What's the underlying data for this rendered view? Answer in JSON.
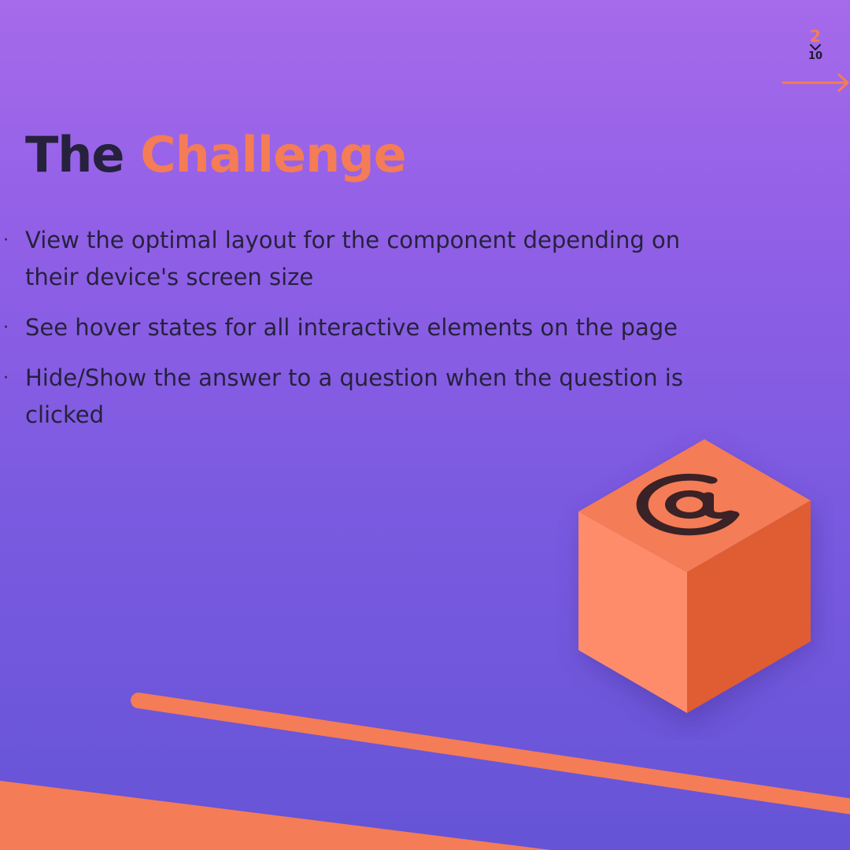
{
  "page_indicator": {
    "current": "2",
    "total": "10",
    "chevron_icon": "chevron-down-icon",
    "next_icon": "arrow-right-icon"
  },
  "title": {
    "part1": "The",
    "part2": "Challenge"
  },
  "bullets": [
    "View the optimal layout for the component depending on their device's screen size",
    "See hover states for all interactive elements on the page",
    "Hide/Show the answer to a question when the question is clicked"
  ],
  "bullet_marker": "·",
  "illustration": {
    "icon": "at-sign-icon"
  },
  "colors": {
    "accent": "#f47c56",
    "text_dark": "#26213d",
    "background_top": "#a66aeb",
    "background_bottom": "#6554d6"
  }
}
